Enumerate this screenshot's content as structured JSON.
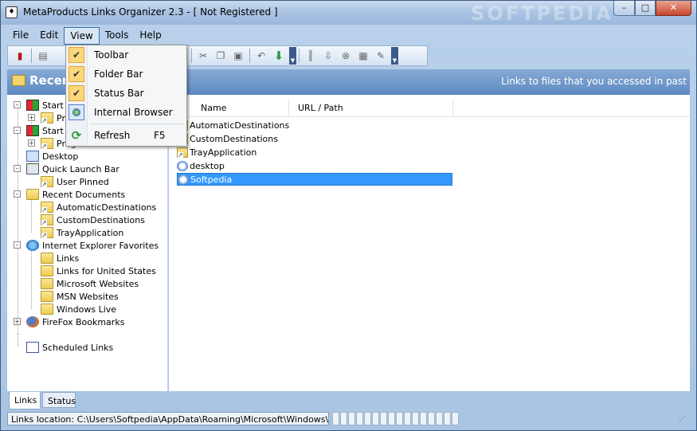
{
  "window": {
    "title": "MetaProducts Links Organizer 2.3 - [ Not Registered ]",
    "watermark": "SOFTPEDIA",
    "min_glyph": "–",
    "max_glyph": "□",
    "close_glyph": "✕"
  },
  "menubar": {
    "items": [
      "File",
      "Edit",
      "View",
      "Tools",
      "Help"
    ]
  },
  "view_menu": {
    "items": [
      {
        "label": "Toolbar",
        "checked": true
      },
      {
        "label": "Folder Bar",
        "checked": true
      },
      {
        "label": "Status Bar",
        "checked": true
      },
      {
        "label": "Internal Browser",
        "checked": false
      },
      {
        "label": "Refresh",
        "shortcut": "F5"
      }
    ],
    "check_glyph": "✔",
    "refresh_glyph": "⟳"
  },
  "header": {
    "title": "Recent Documents",
    "description": "Links to files that you accessed in past"
  },
  "tree": {
    "items": [
      "Start Menu",
      "Programs",
      "Start Menu",
      "Programs",
      "Desktop",
      "Quick Launch Bar",
      "User Pinned",
      "Recent Documents",
      "AutomaticDestinations",
      "CustomDestinations",
      "TrayApplication",
      "Internet Explorer Favorites",
      "Links",
      "Links for United States",
      "Microsoft Websites",
      "MSN Websites",
      "Windows Live",
      "FireFox Bookmarks",
      "Scheduled Links"
    ]
  },
  "list": {
    "columns": [
      "Name",
      "URL / Path"
    ],
    "rows": [
      "AutomaticDestinations",
      "CustomDestinations",
      "TrayApplication",
      "desktop",
      "Softpedia"
    ],
    "selected_index": 4
  },
  "tabs": [
    "Links",
    "Status"
  ],
  "status": {
    "text": "Links location: C:\\Users\\Softpedia\\AppData\\Roaming\\Microsoft\\Windows\\Recent\\"
  },
  "colors": {
    "selection": "#3399ff",
    "header_band": "#5f89c0",
    "menu_check_bg": "#fbd77c"
  }
}
